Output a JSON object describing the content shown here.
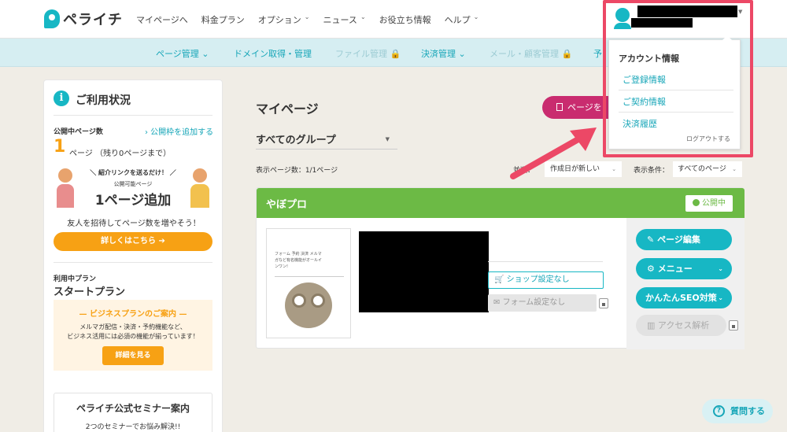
{
  "header": {
    "brand": "ペライチ",
    "nav": [
      {
        "label": "マイページへ",
        "has_caret": false
      },
      {
        "label": "料金プラン",
        "has_caret": false
      },
      {
        "label": "オプション",
        "has_caret": true
      },
      {
        "label": "ニュース",
        "has_caret": true
      },
      {
        "label": "お役立ち情報",
        "has_caret": false
      },
      {
        "label": "ヘルプ",
        "has_caret": true
      }
    ],
    "accent_color": "#17b7c4"
  },
  "subnav": {
    "items": [
      {
        "label": "ページ管理 ⌄",
        "disabled": false
      },
      {
        "label": "ドメイン取得・管理",
        "disabled": false
      },
      {
        "label": "ファイル管理 🔒",
        "disabled": true
      },
      {
        "label": "決済管理 ⌄",
        "disabled": false
      },
      {
        "label": "メール・顧客管理 🔒",
        "disabled": true
      },
      {
        "label": "予",
        "disabled": false
      }
    ]
  },
  "account_menu": {
    "title": "アカウント情報",
    "items": [
      "ご登録情報",
      "ご契約情報",
      "決済履歴"
    ],
    "logout": "ログアウトする"
  },
  "usage": {
    "title": "ご利用状況",
    "pages_label": "公開中ページ数",
    "add_link": "› 公開枠を追加する",
    "count": "1",
    "count_suffix": "ページ （残り0ページまで）",
    "banner_top": "＼ 紹介リンクを送るだけ！ ／",
    "banner_small": "公開可能ページ",
    "banner_big": "1ページ追加",
    "invite_text": "友人を招待してページ数を増やそう！",
    "details_button": "詳しくはこちら ➔",
    "plan_label": "利用中プラン",
    "plan_name": "スタートプラン",
    "biz_title": "— ビジネスプランのご案内 —",
    "biz_text1": "メルマガ配信・決済・予約機能など、",
    "biz_text2": "ビジネス活用には必須の機能が揃っています！",
    "biz_button": "詳細を見る",
    "seminar_title": "ペライチ公式セミナー案内",
    "seminar_text": "2つのセミナーでお悩み解決!!"
  },
  "main": {
    "title": "マイページ",
    "new_page_button": "ページを",
    "group_select": "すべてのグループ",
    "count_label": "表示ページ数：1/1ページ",
    "sort_label": "並",
    "sort_label_tail": "順：",
    "sort_value": "作成日が新しい",
    "filter_label": "表示条件：",
    "filter_value": "すべてのページ"
  },
  "page_card": {
    "title": "やぼプロ",
    "status": "公開中",
    "thumb_text1": "フォーム 予約 決済 メルマ",
    "thumb_text2": "ガなど有名機能がオールイ",
    "thumb_text3": "ンワン!",
    "shop_button": "ショップ設定なし",
    "form_button": "フォーム設定なし",
    "actions": [
      {
        "label": "ページ編集",
        "icon": "pencil-icon",
        "has_caret": false
      },
      {
        "label": "メニュー",
        "icon": "gear-icon",
        "has_caret": true
      },
      {
        "label": "かんたんSEO対策",
        "icon": "",
        "has_caret": true
      }
    ],
    "analytics_button": "アクセス解析"
  },
  "help_button": "質問する",
  "annotation_color": "#ec4866"
}
